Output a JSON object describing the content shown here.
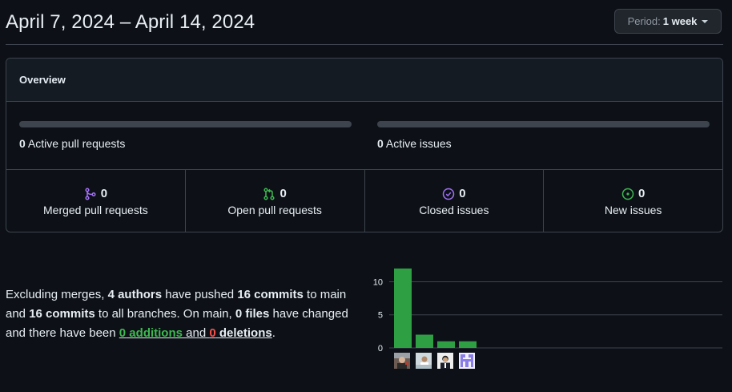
{
  "header": {
    "title": "April 7, 2024 – April 14, 2024",
    "period_label": "Period:",
    "period_value": "1 week"
  },
  "overview": {
    "heading": "Overview",
    "active_prs_count": "0",
    "active_prs_label": "Active pull requests",
    "active_issues_count": "0",
    "active_issues_label": "Active issues",
    "stats": [
      {
        "count": "0",
        "label": "Merged pull requests",
        "icon": "git-merge-icon",
        "color": "#a371f7"
      },
      {
        "count": "0",
        "label": "Open pull requests",
        "icon": "git-pull-request-icon",
        "color": "#3fb950"
      },
      {
        "count": "0",
        "label": "Closed issues",
        "icon": "issue-closed-icon",
        "color": "#a371f7"
      },
      {
        "count": "0",
        "label": "New issues",
        "icon": "issue-opened-icon",
        "color": "#3fb950"
      }
    ]
  },
  "summary": {
    "t1": "Excluding merges, ",
    "authors": "4 authors",
    "t2": " have pushed ",
    "commits_main": "16 commits",
    "t3": " to main and ",
    "commits_all": "16 commits",
    "t4": " to all branches. On main, ",
    "files": "0 files",
    "t5": " have changed and there have been ",
    "additions_num": "0",
    "additions_word": " additions",
    "and": " and ",
    "deletions_num": "0",
    "deletions_word": " deletions",
    "end": "."
  },
  "chart_data": {
    "type": "bar",
    "categories": [
      "author-1",
      "author-2",
      "author-3",
      "author-4"
    ],
    "values": [
      12,
      2,
      1,
      1
    ],
    "yticks": [
      0,
      5,
      10
    ],
    "ylim": [
      0,
      12.6
    ],
    "bar_color": "#2ea043",
    "grid": true
  }
}
